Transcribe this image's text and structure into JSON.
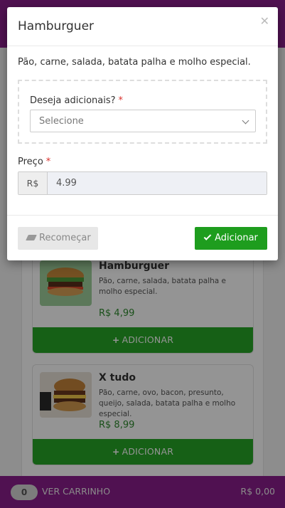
{
  "modal": {
    "title": "Hamburguer",
    "close_icon": "close-icon",
    "description": "Pão, carne, salada, batata palha e molho especial.",
    "addons_label": "Deseja adicionais?",
    "required_mark": "*",
    "addons_placeholder": "Selecione",
    "price_label": "Preço",
    "currency_prefix": "R$",
    "price_value": "4.99",
    "restart_label": "Recomeçar",
    "add_label": "Adicionar"
  },
  "products": [
    {
      "name": "Hamburguer",
      "description": "Pão, carne, salada, batata palha e molho especial.",
      "price": "R$ 4,99",
      "button_label": "ADICIONAR"
    },
    {
      "name": "X tudo",
      "description": "Pão, carne, ovo, bacon, presunto, queijo, salada, batata palha e molho especial.",
      "price": "R$ 8,99",
      "button_label": "ADICIONAR"
    }
  ],
  "cart": {
    "count": "0",
    "label": "VER CARRINHO",
    "total": "R$ 0,00"
  },
  "colors": {
    "brand": "#8b1e8c",
    "accent_green": "#26a526",
    "price_green": "#2e8b2e"
  }
}
